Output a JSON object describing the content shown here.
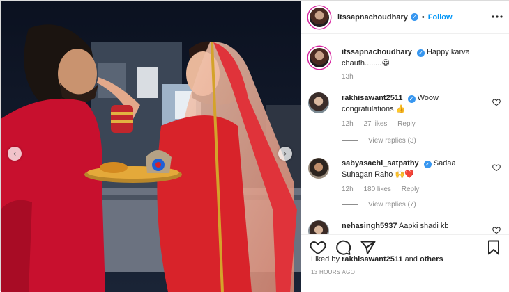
{
  "post": {
    "username": "itssapnachoudhary",
    "verified_mark": "✓",
    "separator": "•",
    "follow_label": "Follow",
    "caption_text": "Happy karva chauth........😀",
    "caption_age": "13h"
  },
  "comments": [
    {
      "username": "rakhisawant2511",
      "text": "Woow congratulations 👍",
      "age": "12h",
      "likes": "27 likes",
      "reply_label": "Reply",
      "view_replies": "View replies (3)"
    },
    {
      "username": "sabyasachi_satpathy",
      "text": "Sadaa Suhagan Raho 🙌❤️",
      "age": "12h",
      "likes": "180 likes",
      "reply_label": "Reply",
      "view_replies": "View replies (7)"
    },
    {
      "username": "nehasingh5937",
      "text": "Aapki shadi kb"
    }
  ],
  "liked_by": {
    "prefix": "Liked by",
    "user": "rakhisawant2511",
    "joiner": "and",
    "others": "others"
  },
  "timestamp": "13 HOURS AGO",
  "icons": {
    "like": "heart-outline-icon",
    "comment": "speech-bubble-icon",
    "share": "paper-plane-icon",
    "save": "bookmark-icon",
    "more": "ellipsis-icon",
    "prev": "chevron-left-icon",
    "next": "chevron-right-icon",
    "carousel_prev_glyph": "‹",
    "carousel_next_glyph": "›"
  },
  "colors": {
    "link_blue": "#0095f6",
    "verified_blue": "#3897f0",
    "muted_gray": "#8e8e8e",
    "story_ring": "#d6249f",
    "saree_red": "#d8232a",
    "kurta_red": "#c8102e"
  }
}
